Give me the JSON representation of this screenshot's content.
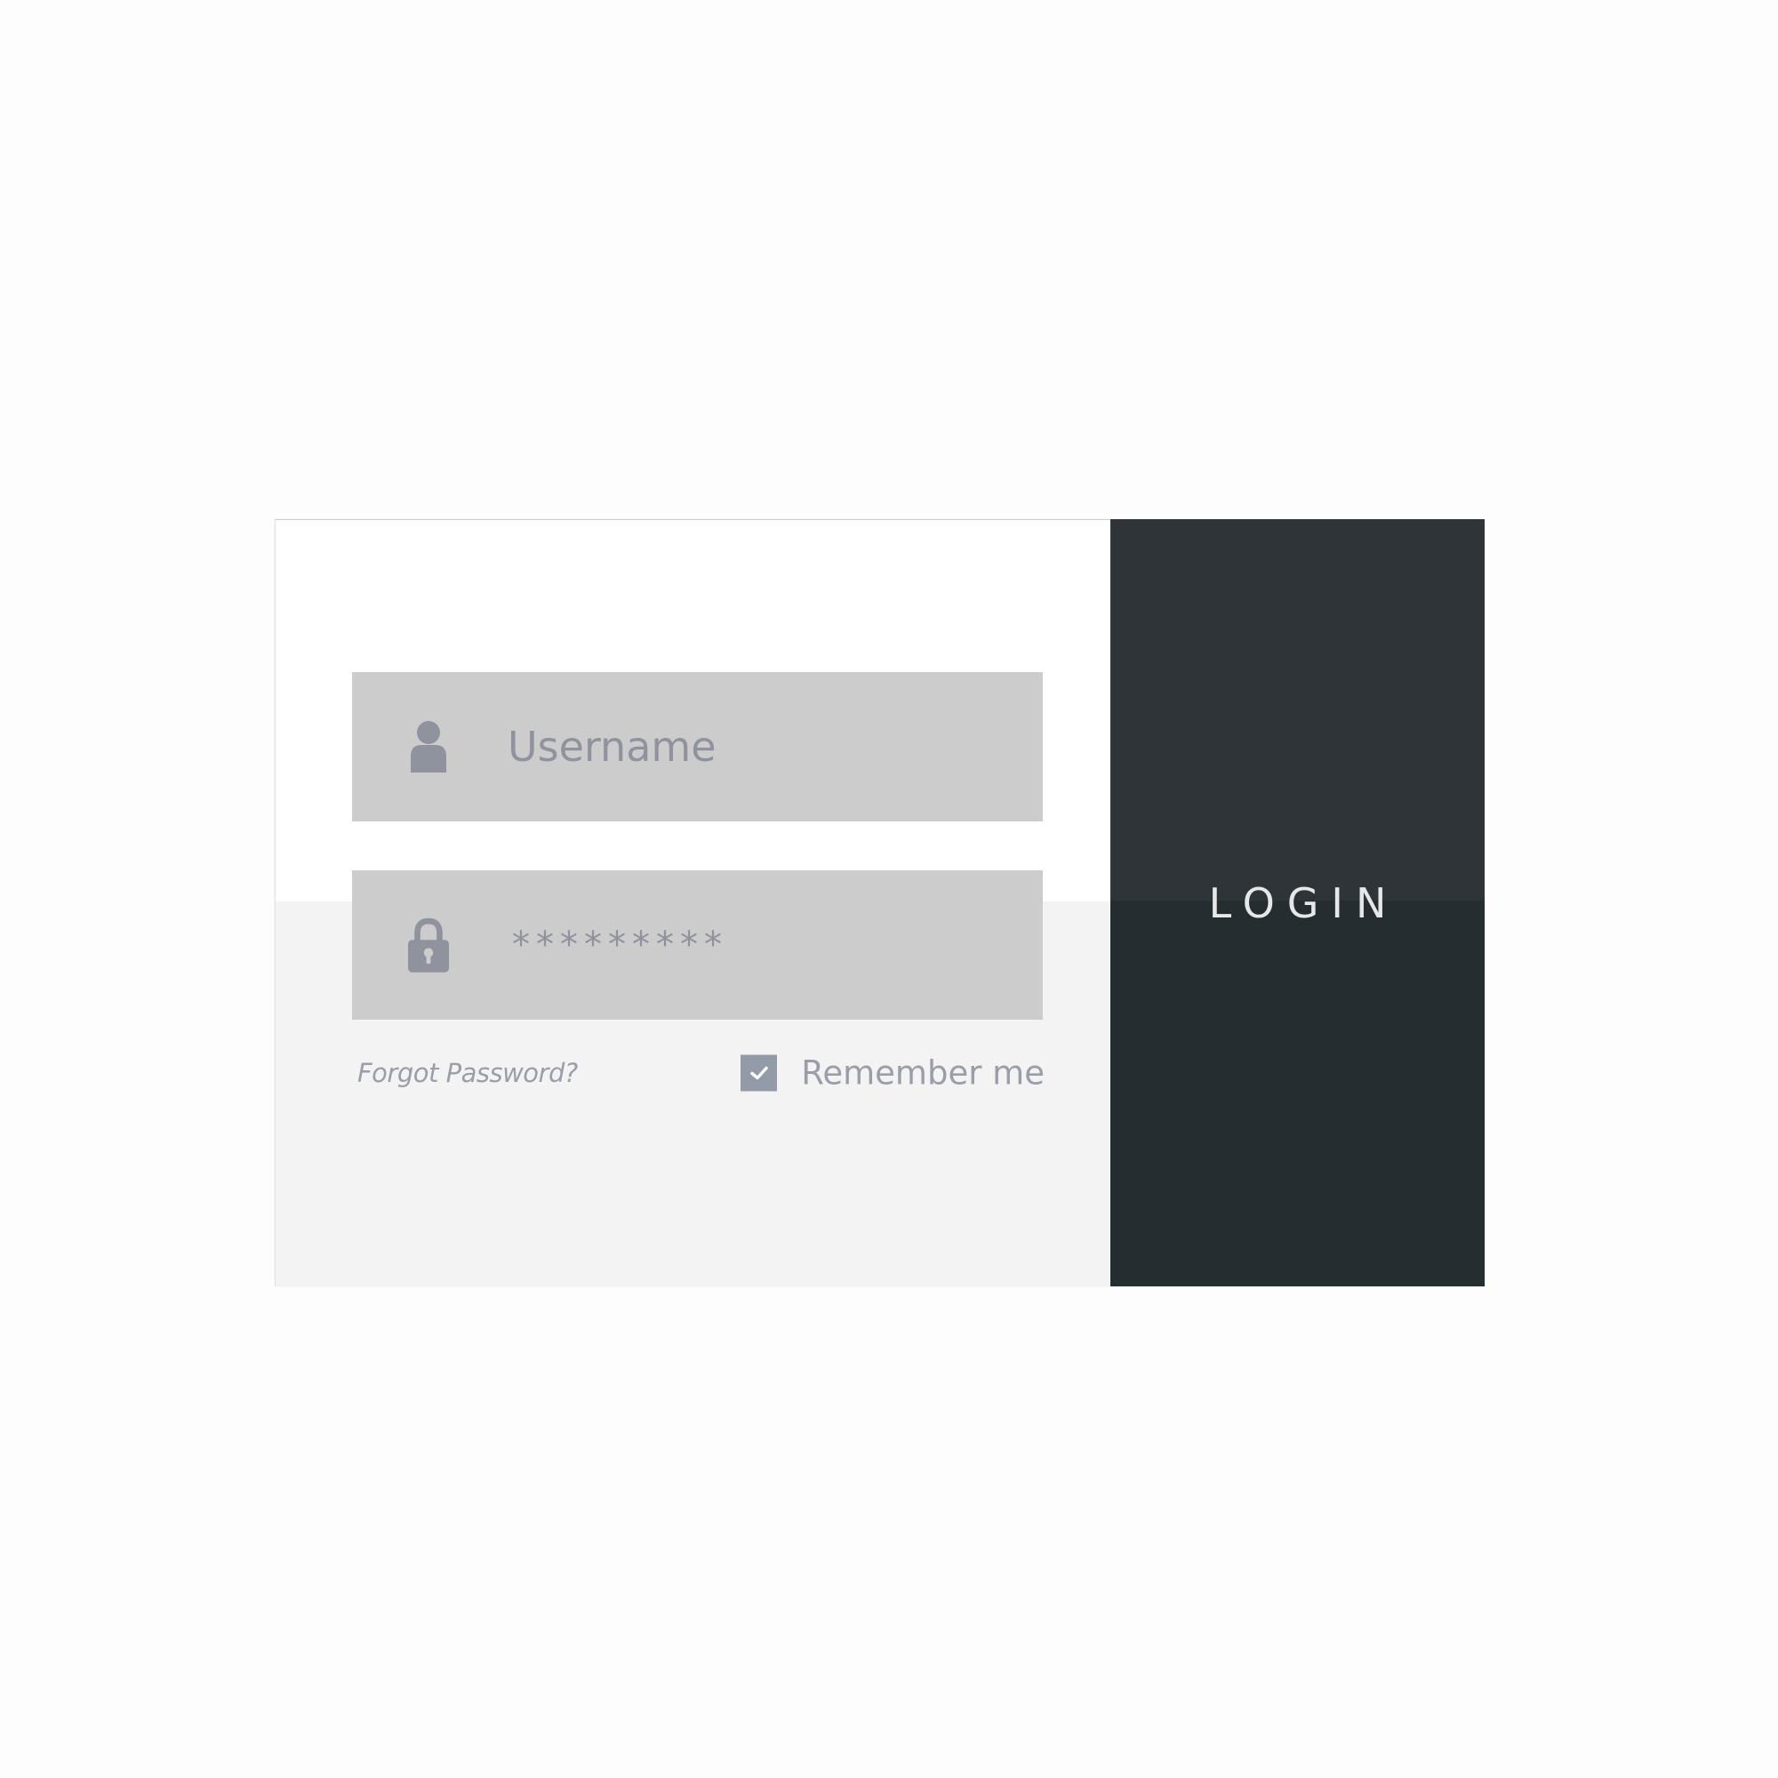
{
  "form": {
    "username": {
      "placeholder": "Username",
      "value": "",
      "icon": "user-icon"
    },
    "password": {
      "value": "*********",
      "icon": "lock-icon"
    },
    "forgot_password_label": "Forgot Password?",
    "remember_me": {
      "label": "Remember me",
      "checked": true
    }
  },
  "login_button": {
    "label": "LOGIN"
  },
  "colors": {
    "field_background": "#cccccc",
    "icon_gray": "#8f939e",
    "button_dark": "#2e3438",
    "button_dark_lower": "#262d31",
    "button_text": "#e6e7e8"
  }
}
